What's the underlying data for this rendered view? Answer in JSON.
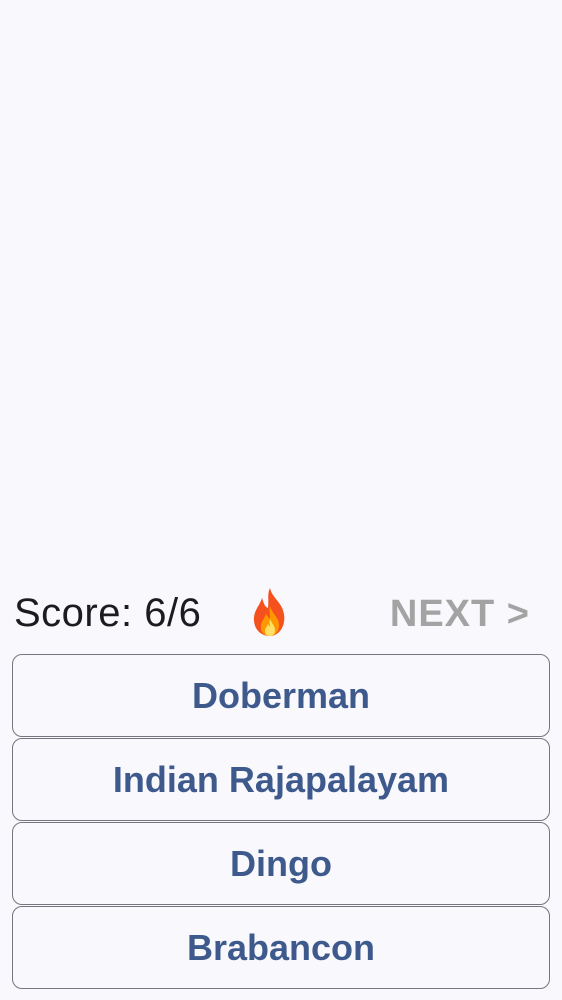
{
  "score": {
    "label": "Score: 6/6",
    "icon": "fire-icon"
  },
  "next": {
    "label": "NEXT >"
  },
  "answers": [
    {
      "label": "Doberman"
    },
    {
      "label": "Indian Rajapalayam"
    },
    {
      "label": "Dingo"
    },
    {
      "label": "Brabancon"
    }
  ],
  "colors": {
    "background": "#f9f8fd",
    "answer_text": "#3e5a8d",
    "answer_border": "#79757f",
    "next_disabled": "#a3a3a3",
    "score_text": "#1c1b1f"
  }
}
